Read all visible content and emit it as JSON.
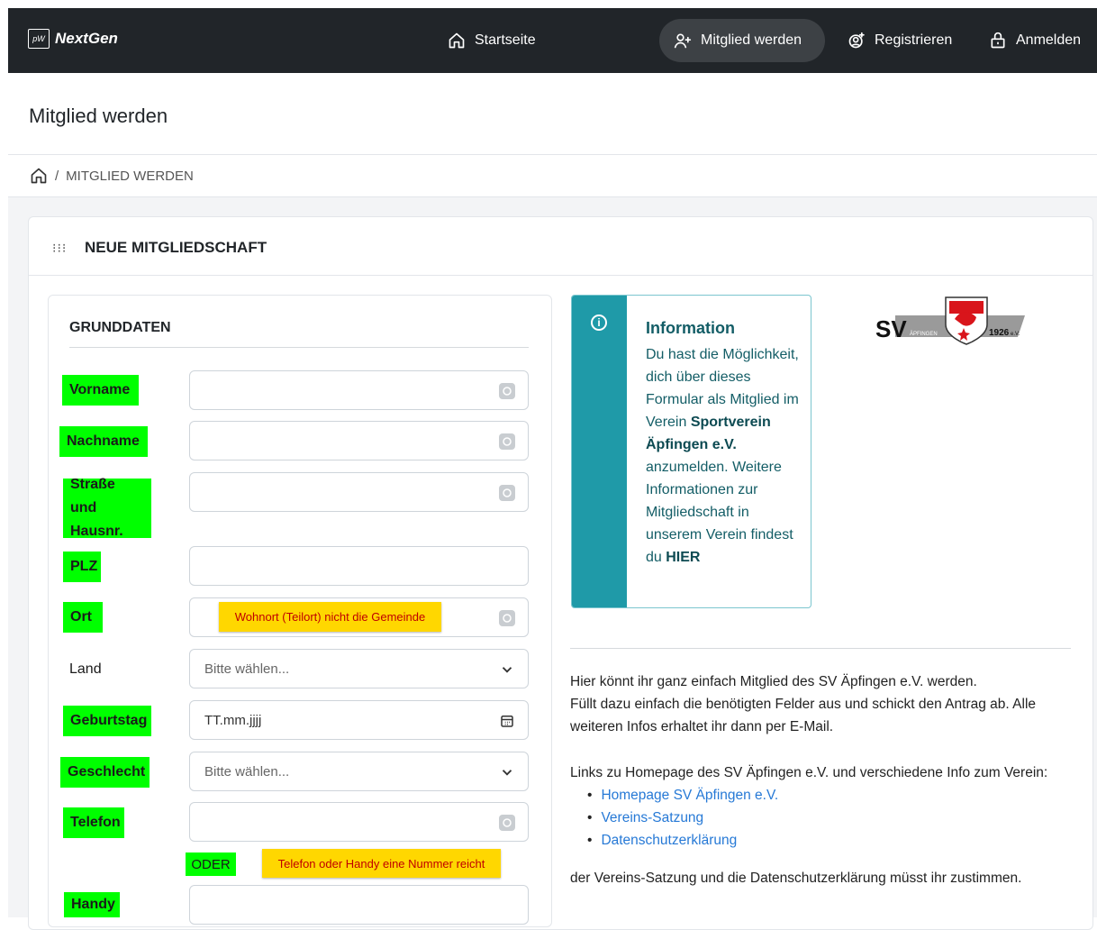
{
  "brand": {
    "logo_mark": "pW",
    "name": "NextGen"
  },
  "nav": {
    "home": "Startseite",
    "join": "Mitglied werden",
    "register": "Registrieren",
    "login": "Anmelden"
  },
  "page": {
    "title": "Mitglied werden"
  },
  "breadcrumb": {
    "separator": "/",
    "current": "MITGLIED WERDEN"
  },
  "card": {
    "title": "NEUE MITGLIEDSCHAFT"
  },
  "form": {
    "section_title": "GRUNDDATEN",
    "labels": {
      "vorname": "Vorname",
      "nachname": "Nachname",
      "strasse": "Straße und Hausnr.",
      "plz": "PLZ",
      "ort": "Ort",
      "land": "Land",
      "geburtstag": "Geburtstag",
      "geschlecht": "Geschlecht",
      "telefon": "Telefon",
      "handy": "Handy"
    },
    "land_placeholder": "Bitte wählen...",
    "geburtstag_placeholder": "TT.mm.jjjj",
    "geschlecht_placeholder": "Bitte wählen...",
    "ort_tip": "Wohnort (Teilort) nicht die Gemeinde",
    "oder": "ODER",
    "phone_tip": "Telefon oder Handy eine Nummer reicht"
  },
  "info": {
    "title": "Information",
    "text1": "Du hast die Möglichkeit, dich über dieses Formular als Mitglied im Verein",
    "club": "Sportverein Äpfingen e.V.",
    "text2": "anzumelden. Weitere Informationen zur Mitgliedschaft in unserem Verein findest du",
    "here": "HIER"
  },
  "logo": {
    "letters": "SV",
    "place": "ÄPFINGEN",
    "year": "1926",
    "suffix": "e.V."
  },
  "description": {
    "p1_line1": "Hier könnt ihr ganz einfach Mitglied des SV Äpfingen e.V. werden.",
    "p1_line2": "Füllt dazu einfach die benötigten Felder aus und schickt den Antrag ab. Alle weiteren Infos erhaltet ihr dann per E-Mail.",
    "links_intro": "Links zu Homepage des SV Äpfingen e.V. und verschiedene Info zum Verein:",
    "links": [
      "Homepage SV Äpfingen e.V.",
      "Vereins-Satzung",
      "Datenschutzerklärung"
    ],
    "consent": "der Vereins-Satzung und die Datenschutzerklärung müsst ihr zustimmen."
  },
  "colors": {
    "navbar": "#212529",
    "highlight": "#00ff00",
    "tip": "#ffd700",
    "info": "#1f9aa8",
    "link": "#2679d6"
  }
}
